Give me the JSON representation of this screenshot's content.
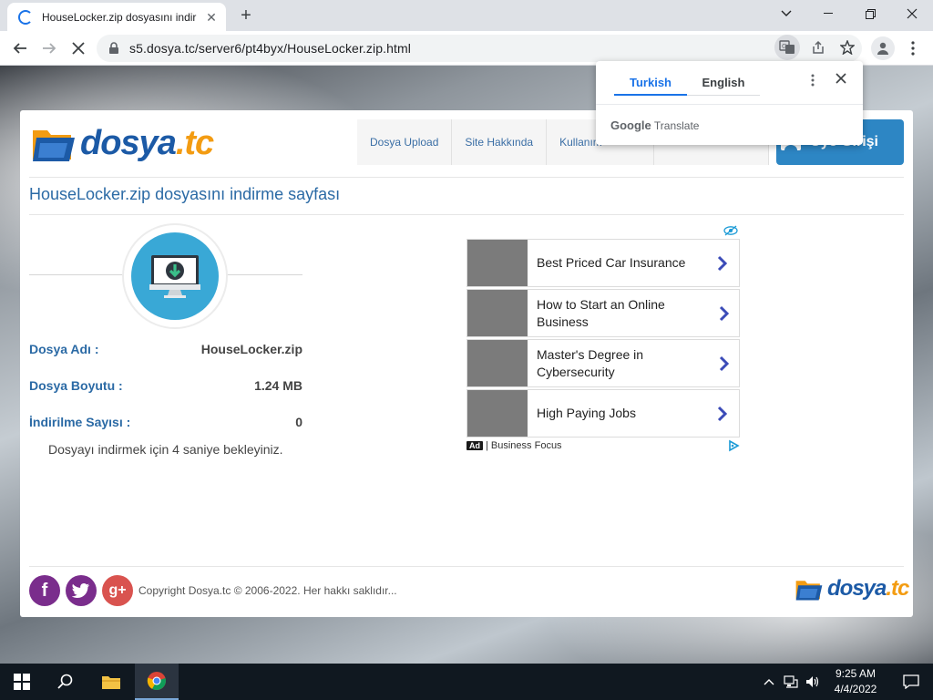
{
  "browser": {
    "tab_title": "HouseLocker.zip dosyasını indir",
    "url": "s5.dosya.tc/server6/pt4byx/HouseLocker.zip.html"
  },
  "translate_popup": {
    "tabs": [
      "Turkish",
      "English"
    ],
    "active_tab": "Turkish",
    "footer_brand": "Google",
    "footer_label": "Translate"
  },
  "site": {
    "logo_text_1": "dosya",
    "logo_text_2": ".tc",
    "nav": [
      "Dosya Upload",
      "Site Hakkında",
      "Kullanım"
    ],
    "login_label": "Üye Girişi",
    "page_title": "HouseLocker.zip dosyasını indirme sayfası",
    "file_info": [
      {
        "key": "Dosya Adı :",
        "value": "HouseLocker.zip"
      },
      {
        "key": "Dosya Boyutu :",
        "value": "1.24 MB"
      },
      {
        "key": "İndirilme Sayısı :",
        "value": "0"
      }
    ],
    "wait_text": "Dosyayı indirmek için 4 saniye bekleyiniz.",
    "copyright": "Copyright Dosya.tc © 2006-2022. Her hakkı saklıdır..."
  },
  "ad": {
    "items": [
      "Best Priced Car Insurance",
      "How to Start an Online Business",
      "Master's Degree in Cybersecurity",
      "High Paying Jobs"
    ],
    "badge": "Ad",
    "source": "| Business Focus"
  },
  "taskbar": {
    "time": "9:25 AM",
    "date": "4/4/2022"
  },
  "colors": {
    "brand_blue": "#1c5aa6",
    "brand_orange": "#f39c12",
    "title_blue": "#2b6aa5",
    "login_blue": "#2d86c4",
    "ad_arrow": "#3b4bb8"
  }
}
